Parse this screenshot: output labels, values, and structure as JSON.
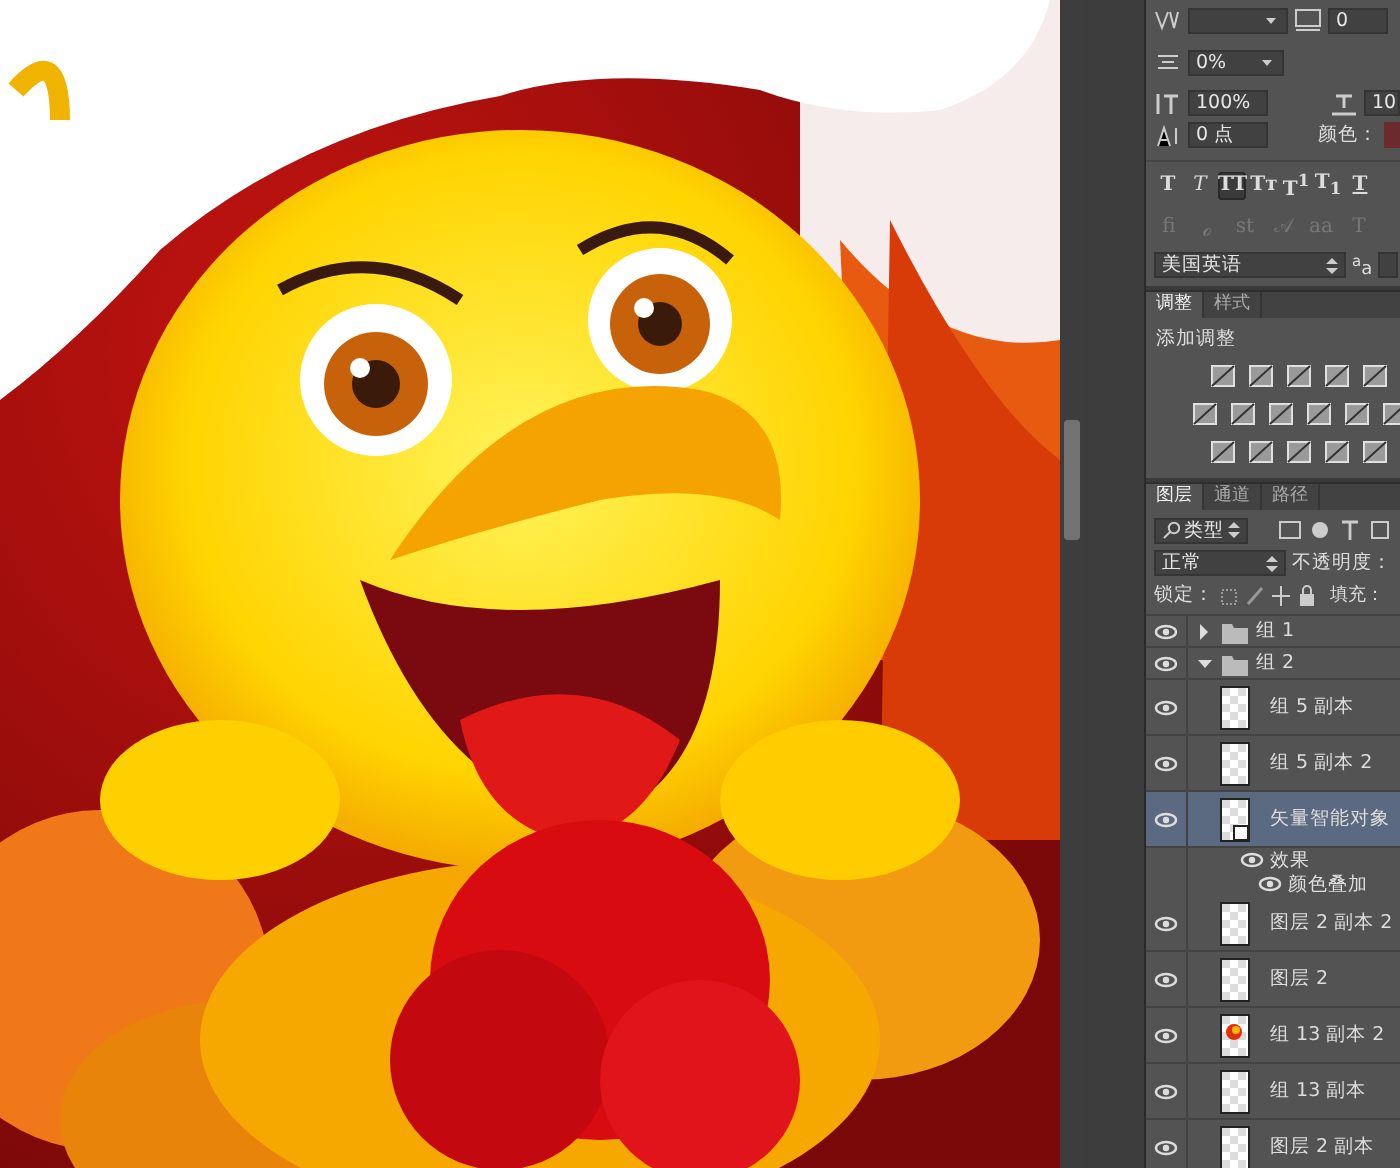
{
  "character": {
    "tracking": "0",
    "proportional_spacing": "0%",
    "vertical_scale": "100%",
    "horizontal_scale": "10",
    "baseline_shift": "0 点",
    "color_label": "颜色：",
    "type_styles": [
      {
        "kind": "bold",
        "label": "T",
        "selected": false
      },
      {
        "kind": "italic",
        "label": "T",
        "selected": false
      },
      {
        "kind": "caps",
        "label": "TT",
        "selected": true
      },
      {
        "kind": "small_caps",
        "label": "Tт",
        "selected": false
      },
      {
        "kind": "super",
        "label": "T$^{1}$",
        "selected": false
      },
      {
        "kind": "sub",
        "label": "T$_{1}$",
        "selected": false
      },
      {
        "kind": "underline",
        "label": "T",
        "selected": false
      }
    ],
    "opentype": [
      "fi",
      "ℴ",
      "st",
      "𝒜",
      "aa",
      "T"
    ],
    "language": "美国英语",
    "antialias": "$^{a}$a"
  },
  "adjustments": {
    "tabs": [
      {
        "label": "调整",
        "selected": true
      },
      {
        "label": "样式",
        "selected": false
      }
    ],
    "title": "添加调整"
  },
  "layers": {
    "tabs": [
      {
        "label": "图层",
        "selected": true
      },
      {
        "label": "通道",
        "selected": false
      },
      {
        "label": "路径",
        "selected": false
      }
    ],
    "filter": "类型",
    "blend_mode": "正常",
    "opacity_label": "不透明度：",
    "lock_label": "锁定：",
    "fill_label": "填充：",
    "items": [
      {
        "kind": "group",
        "name": "组 1",
        "visible": true,
        "expanded": false,
        "selected": false
      },
      {
        "kind": "group",
        "name": "组 2",
        "visible": true,
        "expanded": true,
        "selected": false,
        "children": [
          {
            "kind": "layer",
            "name": "组 5 副本",
            "visible": true,
            "has_artwork": false,
            "selected": false
          },
          {
            "kind": "layer",
            "name": "组 5 副本 2",
            "visible": true,
            "has_artwork": false,
            "selected": false
          },
          {
            "kind": "smart_object",
            "name": "矢量智能对象",
            "visible": true,
            "has_artwork": false,
            "selected": true,
            "children": [
              {
                "kind": "effects",
                "name": "效果",
                "visible": true,
                "children": [
                  {
                    "kind": "effect",
                    "name": "颜色叠加",
                    "visible": true
                  }
                ]
              }
            ]
          },
          {
            "kind": "layer",
            "name": "图层 2 副本 2",
            "visible": true,
            "has_artwork": false,
            "selected": false
          },
          {
            "kind": "layer",
            "name": "图层 2",
            "visible": true,
            "has_artwork": false,
            "selected": false
          },
          {
            "kind": "layer",
            "name": "组 13 副本 2",
            "visible": true,
            "has_artwork": true,
            "selected": false
          },
          {
            "kind": "layer",
            "name": "组 13 副本",
            "visible": true,
            "has_artwork": false,
            "selected": false
          },
          {
            "kind": "layer",
            "name": "图层 2 副本",
            "visible": true,
            "has_artwork": false,
            "selected": false
          }
        ]
      }
    ]
  }
}
